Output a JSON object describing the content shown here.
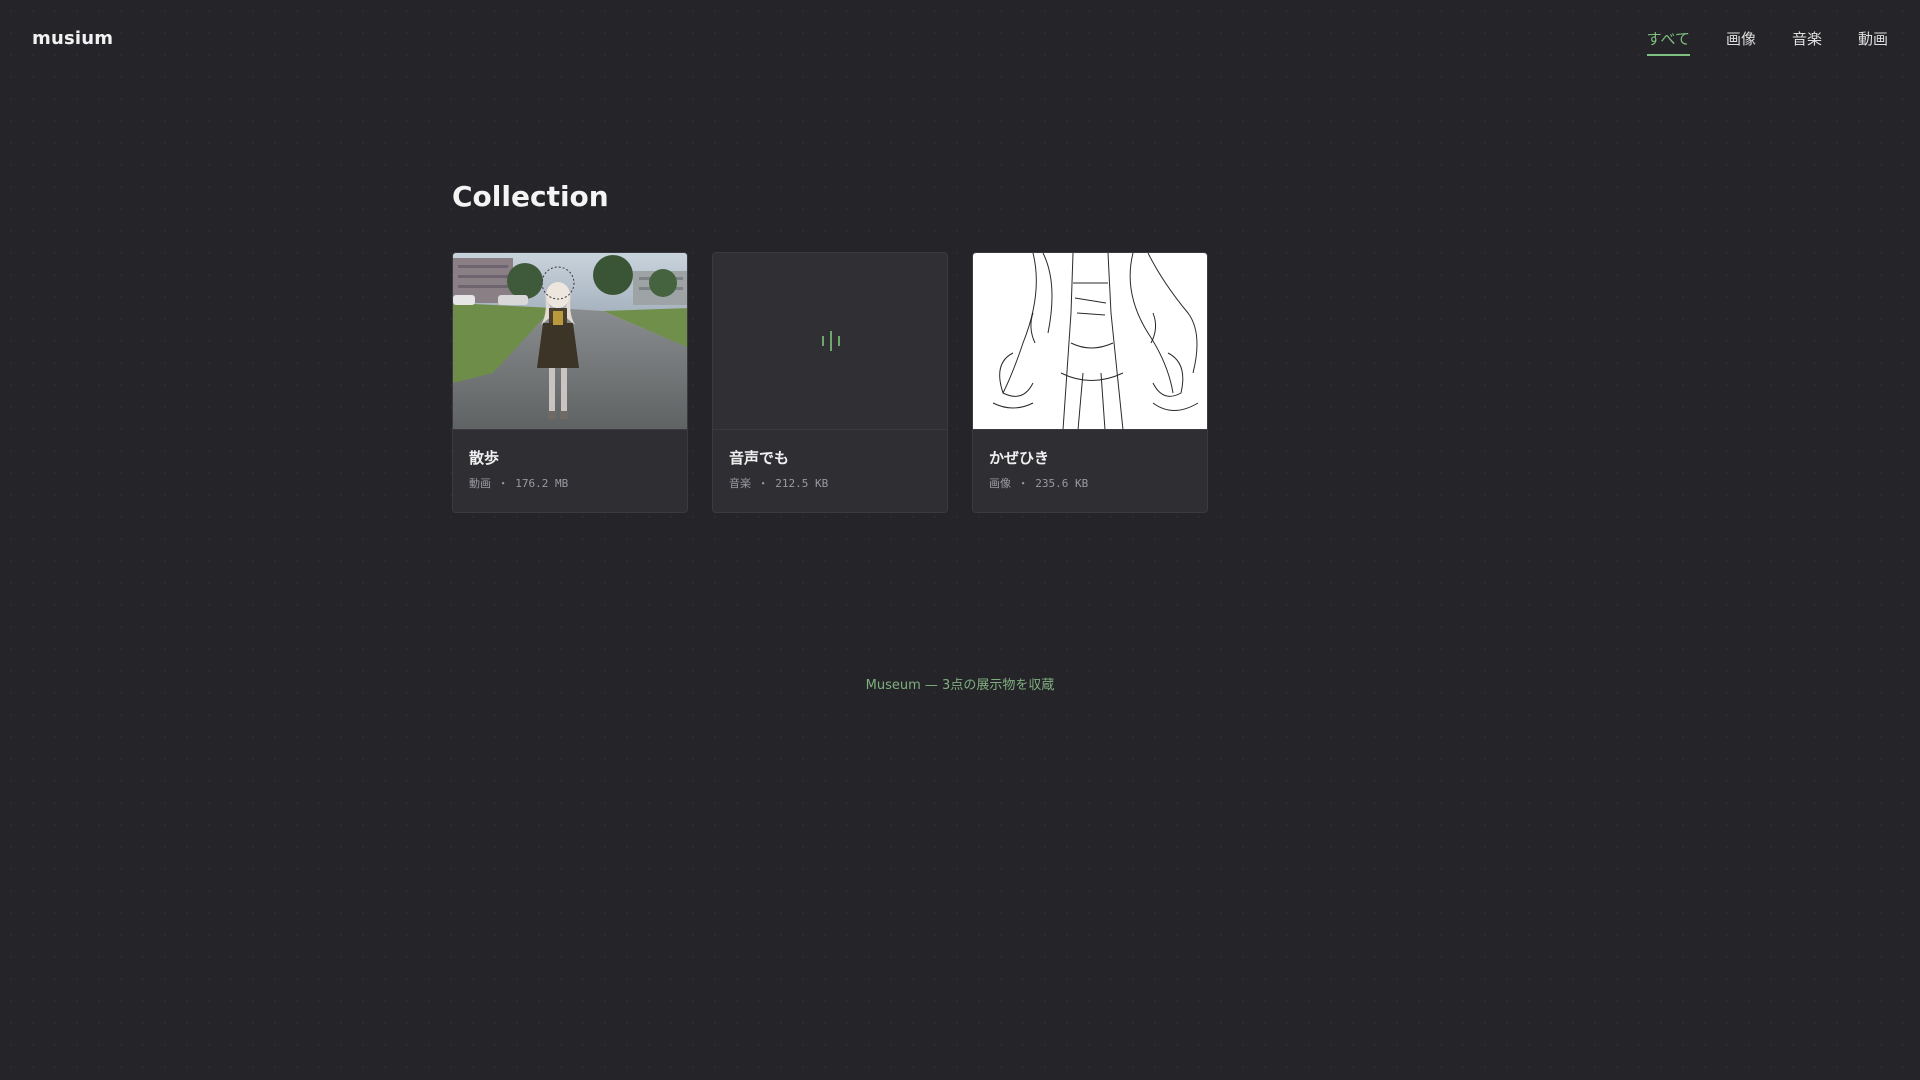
{
  "app": {
    "logo": "musium"
  },
  "nav": {
    "items": [
      {
        "label": "すべて",
        "active": true
      },
      {
        "label": "画像",
        "active": false
      },
      {
        "label": "音楽",
        "active": false
      },
      {
        "label": "動画",
        "active": false
      }
    ]
  },
  "collection": {
    "title": "Collection",
    "cards": [
      {
        "title": "散歩",
        "type": "動画",
        "sep": "・",
        "size": "176.2 MB",
        "thumb": "video"
      },
      {
        "title": "音声でも",
        "type": "音楽",
        "sep": "・",
        "size": "212.5 KB",
        "thumb": "audio-waveform-icon"
      },
      {
        "title": "かぜひき",
        "type": "画像",
        "sep": "・",
        "size": "235.6 KB",
        "thumb": "image"
      }
    ]
  },
  "footer": {
    "text": "Museum — 3点の展示物を収蔵"
  },
  "colors": {
    "accent": "#7fbf7f",
    "background": "#252529",
    "card": "#2e2e33"
  }
}
